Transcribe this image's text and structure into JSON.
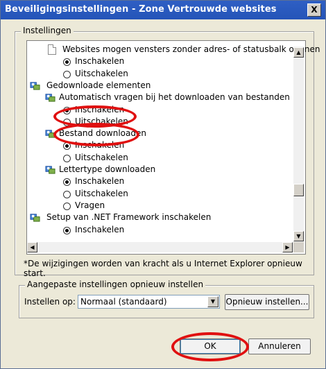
{
  "window": {
    "title": "Beveiligingsinstellingen - Zone Vertrouwde websites",
    "close_label": "X"
  },
  "settings_group": {
    "label": "Instellingen"
  },
  "tree": {
    "items": [
      {
        "kind": "page",
        "text": "Websites mogen vensters zonder adres- of statusbalk openen"
      },
      {
        "kind": "radio",
        "text": "Inschakelen",
        "checked": true
      },
      {
        "kind": "radio",
        "text": "Uitschakelen",
        "checked": false
      },
      {
        "kind": "category",
        "text": "Gedownloade elementen"
      },
      {
        "kind": "subcategory",
        "text": "Automatisch vragen bij het downloaden van bestanden"
      },
      {
        "kind": "radio",
        "text": "Inschakelen",
        "checked": true
      },
      {
        "kind": "radio",
        "text": "Uitschakelen",
        "checked": false
      },
      {
        "kind": "subcategory",
        "text": "Bestand downloaden"
      },
      {
        "kind": "radio",
        "text": "Inschakelen",
        "checked": true
      },
      {
        "kind": "radio",
        "text": "Uitschakelen",
        "checked": false
      },
      {
        "kind": "subcategory",
        "text": "Lettertype downloaden"
      },
      {
        "kind": "radio",
        "text": "Inschakelen",
        "checked": true
      },
      {
        "kind": "radio",
        "text": "Uitschakelen",
        "checked": false
      },
      {
        "kind": "radio",
        "text": "Vragen",
        "checked": false
      },
      {
        "kind": "category",
        "text": "Setup van .NET Framework inschakelen"
      },
      {
        "kind": "radio",
        "text": "Inschakelen",
        "checked": true
      }
    ]
  },
  "note": "*De wijzigingen worden van kracht als u Internet Explorer opnieuw start.",
  "reset_group": {
    "label": "Aangepaste instellingen opnieuw instellen",
    "field_label": "Instellen op:",
    "selected_value": "Normaal (standaard)",
    "reset_button": "Opnieuw instellen..."
  },
  "buttons": {
    "ok": "OK",
    "cancel": "Annuleren"
  },
  "colors": {
    "titlebar": "#2454b8",
    "highlight_ellipse": "#e01010"
  }
}
